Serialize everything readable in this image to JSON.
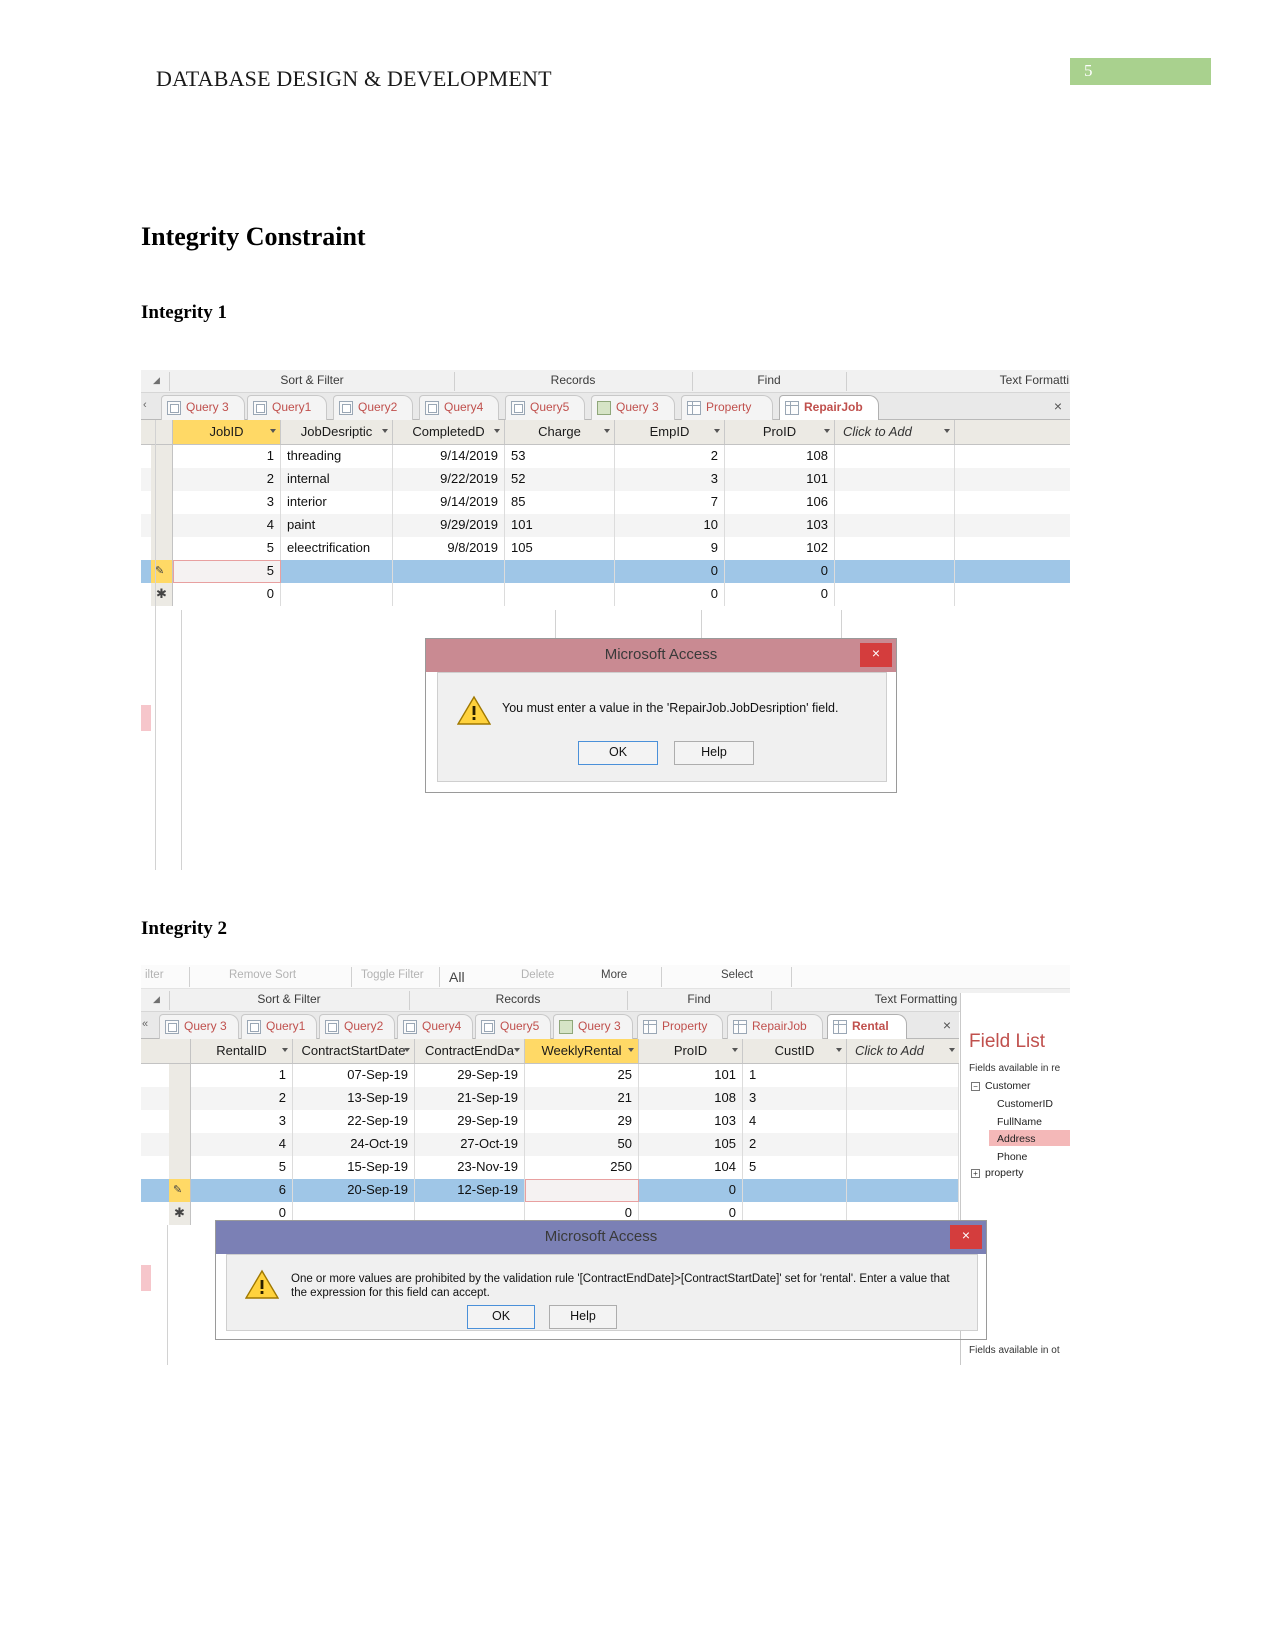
{
  "document": {
    "header_title": "DATABASE DESIGN & DEVELOPMENT",
    "page_number": "5",
    "page_number_color": "#a9d18e",
    "heading_main": "Integrity Constraint",
    "heading_sub1": "Integrity 1",
    "heading_sub2": "Integrity 2"
  },
  "screenshot1": {
    "ribbon_groups": [
      "Sort & Filter",
      "Records",
      "Find",
      "Text Formatti"
    ],
    "tabs": [
      {
        "label": "Query 3",
        "icon": "query-icon",
        "active": false
      },
      {
        "label": "Query1",
        "icon": "query-icon",
        "active": false
      },
      {
        "label": "Query2",
        "icon": "query-icon",
        "active": false
      },
      {
        "label": "Query4",
        "icon": "query-icon",
        "active": false
      },
      {
        "label": "Query5",
        "icon": "query-icon",
        "active": false
      },
      {
        "label": "Query 3",
        "icon": "green-query-icon",
        "active": false
      },
      {
        "label": "Property",
        "icon": "table-icon",
        "active": false
      },
      {
        "label": "RepairJob",
        "icon": "table-icon",
        "active": true
      }
    ],
    "close_label": "×",
    "table": {
      "name": "RepairJob",
      "columns": [
        {
          "label": "JobID",
          "key": true
        },
        {
          "label": "JobDesriptic",
          "key": false
        },
        {
          "label": "CompletedD",
          "key": false
        },
        {
          "label": "Charge",
          "key": false
        },
        {
          "label": "EmpID",
          "key": false
        },
        {
          "label": "ProID",
          "key": false
        },
        {
          "label": "Click to Add",
          "key": false,
          "italic": true
        }
      ],
      "rows": [
        {
          "JobID": "1",
          "JobDesription": "threading",
          "CompletedDate": "9/14/2019",
          "Charge": "53",
          "EmpID": "2",
          "ProID": "108"
        },
        {
          "JobID": "2",
          "JobDesription": "internal",
          "CompletedDate": "9/22/2019",
          "Charge": "52",
          "EmpID": "3",
          "ProID": "101"
        },
        {
          "JobID": "3",
          "JobDesription": "interior",
          "CompletedDate": "9/14/2019",
          "Charge": "85",
          "EmpID": "7",
          "ProID": "106"
        },
        {
          "JobID": "4",
          "JobDesription": "paint",
          "CompletedDate": "9/29/2019",
          "Charge": "101",
          "EmpID": "10",
          "ProID": "103"
        },
        {
          "JobID": "5",
          "JobDesription": "eleectrification",
          "CompletedDate": "9/8/2019",
          "Charge": "105",
          "EmpID": "9",
          "ProID": "102"
        }
      ],
      "editing_row": {
        "JobID": "5",
        "JobDesription": "",
        "CompletedDate": "",
        "Charge": "",
        "EmpID": "0",
        "ProID": "0"
      },
      "new_row": {
        "JobID": "0",
        "JobDesription": "",
        "CompletedDate": "",
        "Charge": "",
        "EmpID": "0",
        "ProID": "0"
      }
    },
    "dialog": {
      "title": "Microsoft Access",
      "title_color": "#c98a92",
      "close_label": "×",
      "message": "You must enter a value in the 'RepairJob.JobDesription' field.",
      "buttons": [
        {
          "label": "OK",
          "primary": true
        },
        {
          "label": "Help",
          "primary": false
        }
      ]
    }
  },
  "screenshot2": {
    "ribbon_top_items": [
      "ilter",
      "Remove Sort",
      "Toggle Filter",
      "All",
      "Delete",
      "More",
      "Select"
    ],
    "ribbon_groups": [
      "Sort & Filter",
      "Records",
      "Find",
      "Text Formatting"
    ],
    "tabs": [
      {
        "label": "Query 3",
        "icon": "query-icon",
        "active": false
      },
      {
        "label": "Query1",
        "icon": "query-icon",
        "active": false
      },
      {
        "label": "Query2",
        "icon": "query-icon",
        "active": false
      },
      {
        "label": "Query4",
        "icon": "query-icon",
        "active": false
      },
      {
        "label": "Query5",
        "icon": "query-icon",
        "active": false
      },
      {
        "label": "Query 3",
        "icon": "green-query-icon",
        "active": false
      },
      {
        "label": "Property",
        "icon": "table-icon",
        "active": false
      },
      {
        "label": "RepairJob",
        "icon": "table-icon",
        "active": false
      },
      {
        "label": "Rental",
        "icon": "table-icon",
        "active": true
      }
    ],
    "close_label": "×",
    "table": {
      "name": "Rental",
      "columns": [
        {
          "label": "RentalID",
          "key": false
        },
        {
          "label": "ContractStartDate",
          "key": false
        },
        {
          "label": "ContractEndDa",
          "key": false
        },
        {
          "label": "WeeklyRental",
          "key": true
        },
        {
          "label": "ProID",
          "key": false
        },
        {
          "label": "CustID",
          "key": false
        },
        {
          "label": "Click to Add",
          "key": false,
          "italic": true
        }
      ],
      "rows": [
        {
          "RentalID": "1",
          "ContractStartDate": "07-Sep-19",
          "ContractEndDate": "29-Sep-19",
          "WeeklyRental": "25",
          "ProID": "101",
          "CustID": "1"
        },
        {
          "RentalID": "2",
          "ContractStartDate": "13-Sep-19",
          "ContractEndDate": "21-Sep-19",
          "WeeklyRental": "21",
          "ProID": "108",
          "CustID": "3"
        },
        {
          "RentalID": "3",
          "ContractStartDate": "22-Sep-19",
          "ContractEndDate": "29-Sep-19",
          "WeeklyRental": "29",
          "ProID": "103",
          "CustID": "4"
        },
        {
          "RentalID": "4",
          "ContractStartDate": "24-Oct-19",
          "ContractEndDate": "27-Oct-19",
          "WeeklyRental": "50",
          "ProID": "105",
          "CustID": "2"
        },
        {
          "RentalID": "5",
          "ContractStartDate": "15-Sep-19",
          "ContractEndDate": "23-Nov-19",
          "WeeklyRental": "250",
          "ProID": "104",
          "CustID": "5"
        }
      ],
      "editing_row": {
        "RentalID": "6",
        "ContractStartDate": "20-Sep-19",
        "ContractEndDate": "12-Sep-19",
        "WeeklyRental": "",
        "ProID": "0",
        "CustID": ""
      },
      "new_row": {
        "RentalID": "0",
        "ContractStartDate": "",
        "ContractEndDate": "",
        "WeeklyRental": "0",
        "ProID": "0",
        "CustID": ""
      }
    },
    "field_list": {
      "title": "Field List",
      "subtitle": "Fields available in re",
      "group_label": "Customer",
      "fields": [
        "CustomerID",
        "FullName",
        "Address",
        "Phone"
      ],
      "highlighted_field": "Address",
      "second_group": "property",
      "bottom_note": "Fields available in ot"
    },
    "dialog": {
      "title": "Microsoft Access",
      "title_color": "#7b80b5",
      "close_label": "×",
      "message": "One or more values are prohibited by the validation rule '[ContractEndDate]>[ContractStartDate]' set for 'rental'. Enter a value that the expression for this field can accept.",
      "buttons": [
        {
          "label": "OK",
          "primary": true
        },
        {
          "label": "Help",
          "primary": false
        }
      ]
    }
  }
}
